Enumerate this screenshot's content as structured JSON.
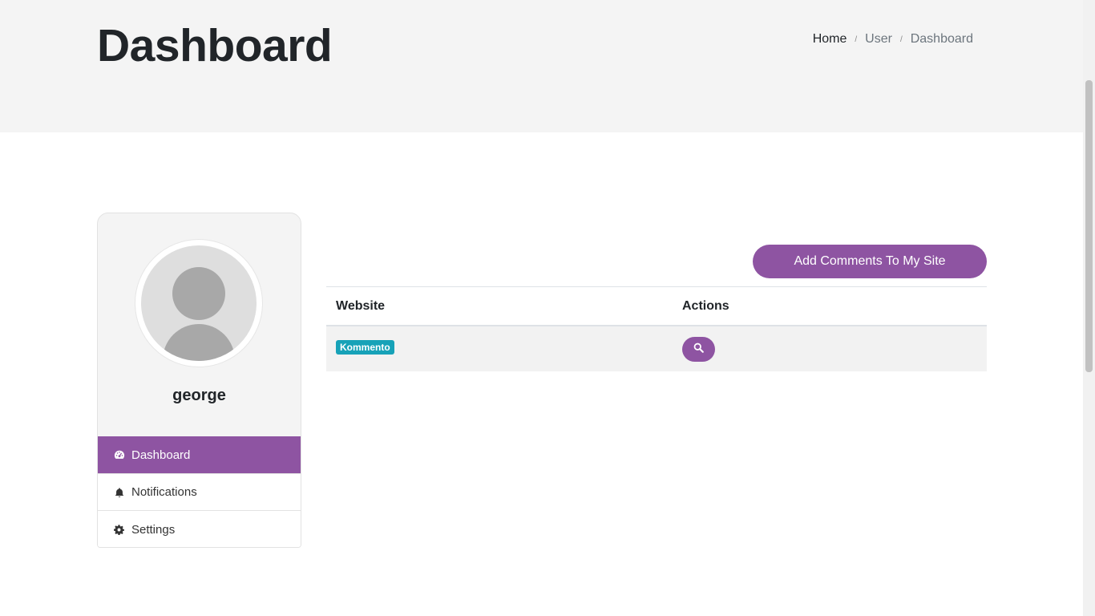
{
  "header": {
    "title": "Dashboard",
    "breadcrumb": [
      {
        "label": "Home"
      },
      {
        "label": "User"
      },
      {
        "label": "Dashboard"
      }
    ],
    "separator": "/"
  },
  "profile": {
    "username": "george",
    "menu": [
      {
        "label": "Dashboard",
        "icon": "tachometer-icon",
        "active": true
      },
      {
        "label": "Notifications",
        "icon": "bell-icon",
        "active": false
      },
      {
        "label": "Settings",
        "icon": "gear-icon",
        "active": false
      }
    ]
  },
  "main": {
    "add_button_label": "Add Comments To My Site",
    "table": {
      "headers": {
        "website": "Website",
        "actions": "Actions"
      },
      "rows": [
        {
          "website_badge": "Kommento",
          "action_icon": "search-icon"
        }
      ]
    }
  },
  "colors": {
    "accent": "#8e54a2",
    "badge": "#17a2b8",
    "hero_bg": "#f4f4f4"
  }
}
